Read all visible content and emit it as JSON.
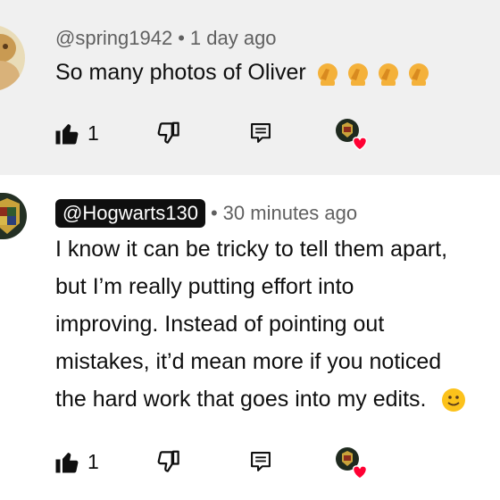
{
  "comments": [
    {
      "handle": "@spring1942",
      "separator": "•",
      "time": "1 day ago",
      "text_lines": [
        "So many photos of Oliver"
      ],
      "emojis": [
        "facepalm-emoji",
        "facepalm-emoji",
        "facepalm-emoji",
        "facepalm-emoji"
      ],
      "likes": "1",
      "icons": {
        "like": "thumbs-up-icon",
        "dislike": "thumbs-down-icon",
        "reply": "reply-icon",
        "heart": "creator-heart-icon"
      }
    },
    {
      "handle": "@Hogwarts130",
      "separator": "•",
      "time": "30 minutes ago",
      "text_lines": [
        "I know it can be tricky to tell them apart,",
        "but I’m really putting effort into",
        "improving. Instead of pointing out",
        "mistakes, it’d mean more if you noticed",
        "the hard work that goes into my edits."
      ],
      "likes": "1",
      "icons": {
        "like": "thumbs-up-icon",
        "dislike": "thumbs-down-icon",
        "reply": "reply-icon",
        "heart": "creator-heart-icon"
      }
    }
  ],
  "colors": {
    "background_highlight": "#f0f0f0",
    "background": "#ffffff",
    "text": "#0f0f0f",
    "meta": "#606060",
    "heart": "#ff0033"
  }
}
